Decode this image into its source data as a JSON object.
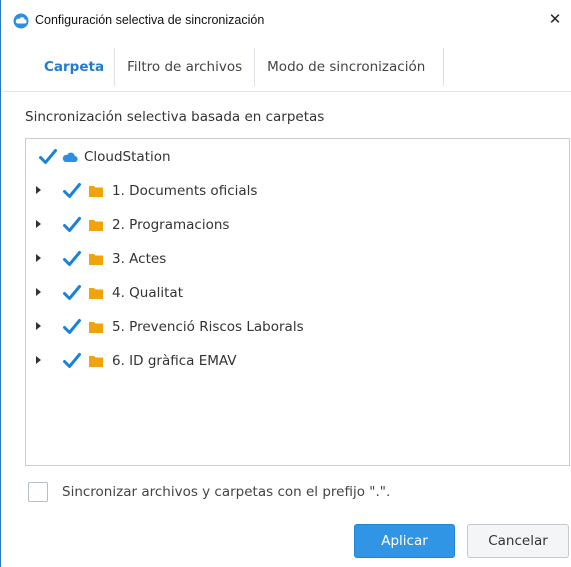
{
  "window": {
    "title": "Configuración selectiva de sincronización",
    "close_glyph": "✕"
  },
  "tabs": [
    {
      "label": "Carpeta",
      "active": true
    },
    {
      "label": "Filtro de archivos",
      "active": false
    },
    {
      "label": "Modo de sincronización",
      "active": false
    }
  ],
  "section_label": "Sincronización selectiva basada en carpetas",
  "tree": {
    "root": {
      "label": "CloudStation",
      "checked": true,
      "icon": "cloud-icon"
    },
    "folders": [
      {
        "label": "1. Documents oficials",
        "checked": true,
        "icon": "folder-icon"
      },
      {
        "label": "2. Programacions",
        "checked": true,
        "icon": "folder-icon"
      },
      {
        "label": "3. Actes",
        "checked": true,
        "icon": "folder-icon"
      },
      {
        "label": "4. Qualitat",
        "checked": true,
        "icon": "folder-icon"
      },
      {
        "label": "5. Prevenció Riscos Laborals",
        "checked": true,
        "icon": "folder-icon"
      },
      {
        "label": "6. ID gràfica EMAV",
        "checked": true,
        "icon": "folder-icon"
      }
    ]
  },
  "prefix_option": {
    "label": "Sincronizar archivos y carpetas con el prefijo \".\".",
    "checked": false
  },
  "buttons": {
    "apply": "Aplicar",
    "cancel": "Cancelar"
  },
  "colors": {
    "accent": "#1f7ccf",
    "check": "#1a82d8",
    "folder": "#f0a30a",
    "cloud": "#2d8fe0",
    "apply_bg": "#2f95e4"
  }
}
